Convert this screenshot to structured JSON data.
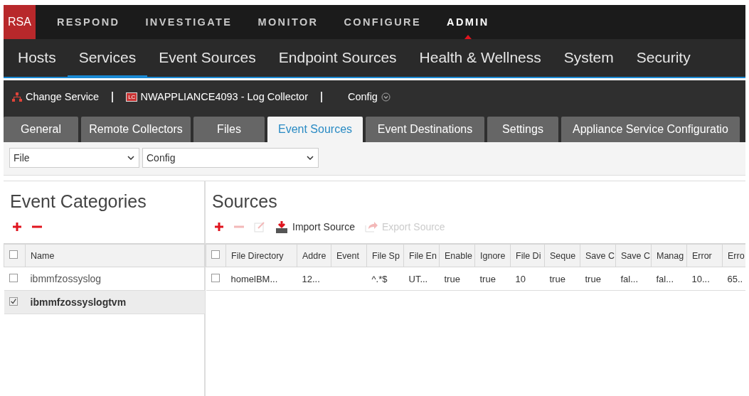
{
  "top_nav": {
    "logo": "RSA",
    "items": [
      {
        "label": "RESPOND",
        "selected": false
      },
      {
        "label": "INVESTIGATE",
        "selected": false
      },
      {
        "label": "MONITOR",
        "selected": false
      },
      {
        "label": "CONFIGURE",
        "selected": false
      },
      {
        "label": "ADMIN",
        "selected": true
      }
    ]
  },
  "sub_nav": {
    "items": [
      {
        "label": "Hosts",
        "selected": false
      },
      {
        "label": "Services",
        "selected": true
      },
      {
        "label": "Event Sources",
        "selected": false
      },
      {
        "label": "Endpoint Sources",
        "selected": false
      },
      {
        "label": "Health & Wellness",
        "selected": false
      },
      {
        "label": "System",
        "selected": false
      },
      {
        "label": "Security",
        "selected": false
      }
    ]
  },
  "service_bar": {
    "change_service": "Change Service",
    "service_badge": "LC",
    "service": "NWAPPLIANCE4093 - Log Collector",
    "view": "Config"
  },
  "tabs": [
    {
      "label": "General",
      "selected": false
    },
    {
      "label": "Remote Collectors",
      "selected": false
    },
    {
      "label": "Files",
      "selected": false
    },
    {
      "label": "Event Sources",
      "selected": true
    },
    {
      "label": "Event Destinations",
      "selected": false
    },
    {
      "label": "Settings",
      "selected": false
    },
    {
      "label": "Appliance Service Configuratio",
      "selected": false
    }
  ],
  "filters": [
    {
      "value": "File"
    },
    {
      "value": "Config"
    }
  ],
  "event_categories": {
    "title": "Event Categories",
    "toolbar": [
      {
        "kind": "add",
        "disabled": false
      },
      {
        "kind": "remove",
        "disabled": false
      }
    ],
    "header_checked": false,
    "columns": [
      "Name"
    ],
    "rows": [
      {
        "name": "ibmmfzossyslog",
        "checked": false,
        "selected": false
      },
      {
        "name": "ibmmfzossyslogtvm",
        "checked": true,
        "selected": true
      }
    ]
  },
  "sources": {
    "title": "Sources",
    "toolbar": [
      {
        "kind": "add",
        "disabled": false
      },
      {
        "kind": "remove",
        "disabled": true
      },
      {
        "kind": "edit",
        "disabled": true
      },
      {
        "kind": "import",
        "label": "Import Source",
        "disabled": false
      },
      {
        "kind": "export",
        "label": "Export Source",
        "disabled": true
      }
    ],
    "header_checked": false,
    "columns": [
      "File Directory",
      "Addre",
      "Event",
      "File Sp",
      "File En",
      "Enable",
      "Ignore",
      "File Di",
      "Seque",
      "Save C",
      "Save C",
      "Manag",
      "Error",
      "Erro"
    ],
    "rows": [
      {
        "checked": false,
        "cells": [
          "homelBM...",
          "12...",
          null,
          "^.*$",
          "UT...",
          "true",
          "true",
          "10",
          "true",
          "true",
          "fal...",
          "fal...",
          "10...",
          "65.."
        ]
      }
    ]
  }
}
